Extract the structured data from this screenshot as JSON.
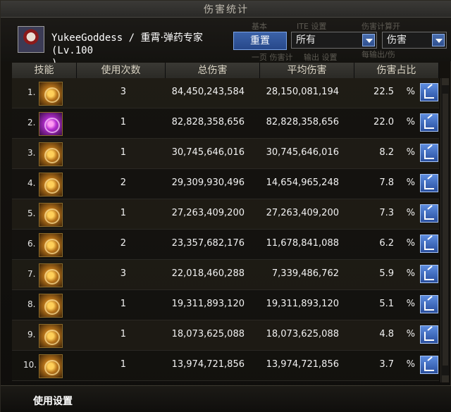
{
  "window": {
    "title": "伤害统计"
  },
  "player": {
    "name": "YukeeGoddess",
    "separator": "/",
    "class": "重霄·弹药专家",
    "level": "(Lv.100",
    "level_close": ")"
  },
  "controls": {
    "reset_label": "重置",
    "filter": {
      "selected": "所有"
    },
    "type": {
      "selected": "伤害"
    }
  },
  "background_labels": {
    "a": "基本",
    "b": "ITE 设置",
    "c": "伤害计算开",
    "d": "每输出/伤",
    "e": "一页 伤害计",
    "f": "输出 设置"
  },
  "columns": [
    "技能",
    "使用次数",
    "总伤害",
    "平均伤害",
    "伤害占比"
  ],
  "rows": [
    {
      "rank": "1.",
      "uses": "3",
      "total": "84,450,243,584",
      "avg": "28,150,081,194",
      "pct": "22.5",
      "pct_symbol": "%",
      "icon": "gold-burst-icon"
    },
    {
      "rank": "2.",
      "uses": "1",
      "total": "82,828,358,656",
      "avg": "82,828,358,656",
      "pct": "22.0",
      "pct_symbol": "%",
      "icon": "purple-orb-icon"
    },
    {
      "rank": "3.",
      "uses": "1",
      "total": "30,745,646,016",
      "avg": "30,745,646,016",
      "pct": "8.2",
      "pct_symbol": "%",
      "icon": "gold-wave-icon"
    },
    {
      "rank": "4.",
      "uses": "2",
      "total": "29,309,930,496",
      "avg": "14,654,965,248",
      "pct": "7.8",
      "pct_symbol": "%",
      "icon": "gold-shot-icon"
    },
    {
      "rank": "5.",
      "uses": "1",
      "total": "27,263,409,200",
      "avg": "27,263,409,200",
      "pct": "7.3",
      "pct_symbol": "%",
      "icon": "gold-shield-icon"
    },
    {
      "rank": "6.",
      "uses": "2",
      "total": "23,357,682,176",
      "avg": "11,678,841,088",
      "pct": "6.2",
      "pct_symbol": "%",
      "icon": "gold-arrow-icon"
    },
    {
      "rank": "7.",
      "uses": "3",
      "total": "22,018,460,288",
      "avg": "7,339,486,762",
      "pct": "5.9",
      "pct_symbol": "%",
      "icon": "gold-spark-icon"
    },
    {
      "rank": "8.",
      "uses": "1",
      "total": "19,311,893,120",
      "avg": "19,311,893,120",
      "pct": "5.1",
      "pct_symbol": "%",
      "icon": "gold-swirl-icon"
    },
    {
      "rank": "9.",
      "uses": "1",
      "total": "18,073,625,088",
      "avg": "18,073,625,088",
      "pct": "4.8",
      "pct_symbol": "%",
      "icon": "gold-star-icon"
    },
    {
      "rank": "10.",
      "uses": "1",
      "total": "13,974,721,856",
      "avg": "13,974,721,856",
      "pct": "3.7",
      "pct_symbol": "%",
      "icon": "gold-beam-icon"
    }
  ],
  "footer": {
    "settings_label": "使用设置"
  }
}
